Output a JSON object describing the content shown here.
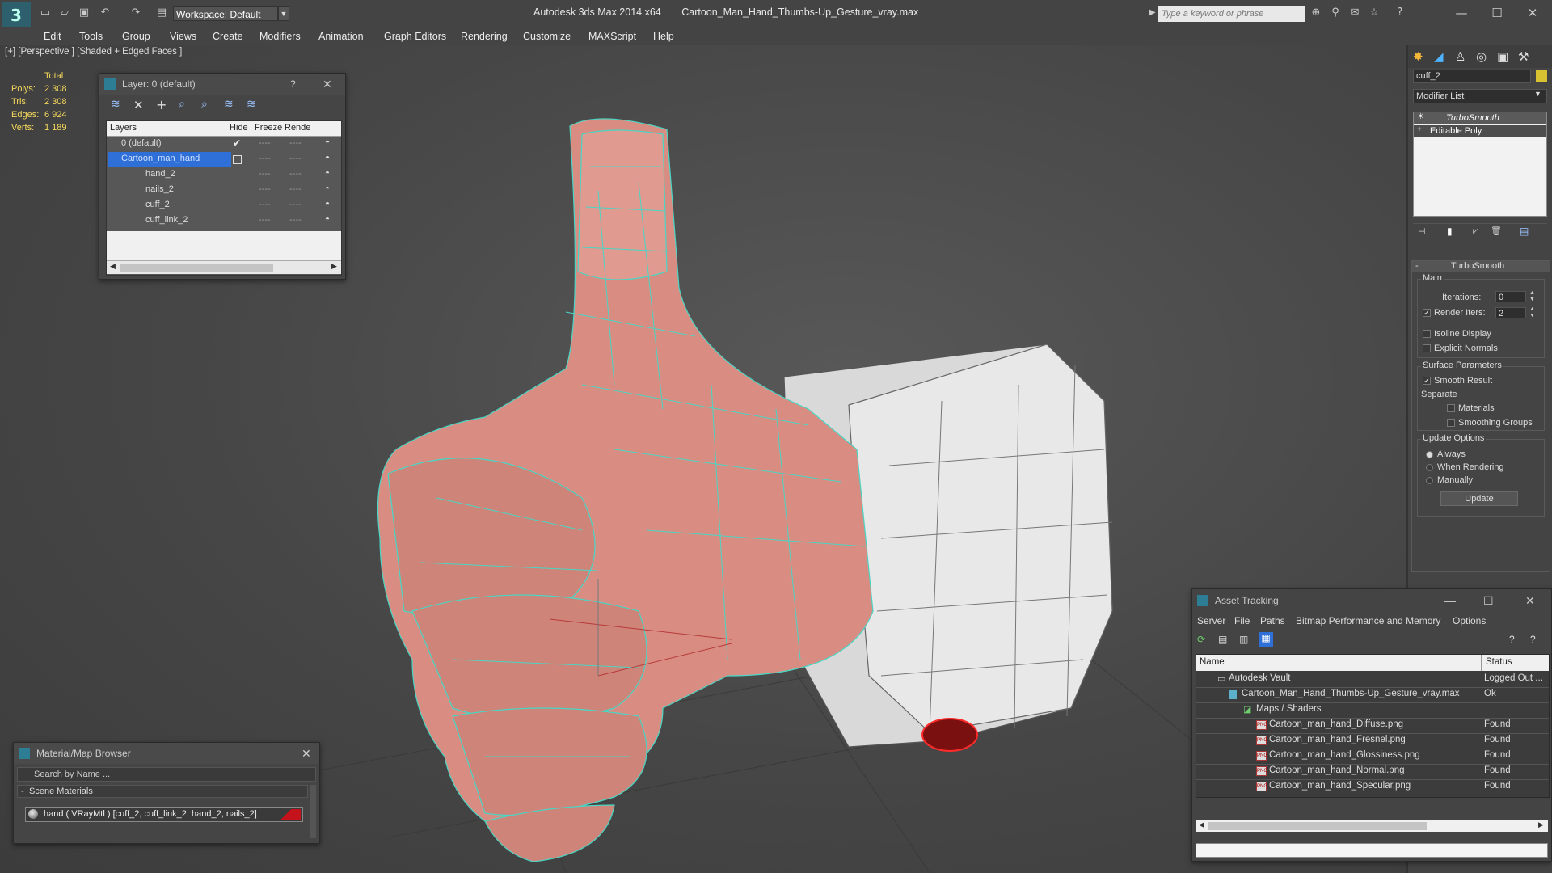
{
  "titlebar": {
    "app_title": "Autodesk 3ds Max  2014 x64",
    "file_title": "Cartoon_Man_Hand_Thumbs-Up_Gesture_vray.max",
    "workspace_label": "Workspace: Default",
    "search_placeholder": "Type a keyword or phrase"
  },
  "menu": [
    "Edit",
    "Tools",
    "Group",
    "Views",
    "Create",
    "Modifiers",
    "Animation",
    "Graph Editors",
    "Rendering",
    "Customize",
    "MAXScript",
    "Help"
  ],
  "viewport": {
    "label": "[+] [Perspective ] [Shaded + Edged Faces ]",
    "stats": {
      "header": "Total",
      "rows": [
        {
          "label": "Polys:",
          "value": "2 308"
        },
        {
          "label": "Tris:",
          "value": "2 308"
        },
        {
          "label": "Edges:",
          "value": "6 924"
        },
        {
          "label": "Verts:",
          "value": "1 189"
        }
      ]
    }
  },
  "layer_panel": {
    "title": "Layer: 0 (default)",
    "help": "?",
    "columns": [
      "Layers",
      "Hide",
      "Freeze",
      "Rende"
    ],
    "rows": [
      {
        "name": "0 (default)"
      },
      {
        "name": "Cartoon_man_hand"
      },
      {
        "name": "hand_2"
      },
      {
        "name": "nails_2"
      },
      {
        "name": "cuff_2"
      },
      {
        "name": "cuff_link_2"
      }
    ],
    "dots": "----"
  },
  "material_browser": {
    "title": "Material/Map Browser",
    "search_placeholder": "Search by Name ...",
    "section": "Scene Materials",
    "material": "hand  ( VRayMtl )  [cuff_2, cuff_link_2, hand_2, nails_2]"
  },
  "command_panel": {
    "object_name": "cuff_2",
    "modifier_list": "Modifier List",
    "stack": [
      "TurboSmooth",
      "Editable Poly"
    ],
    "rollout_title": "TurboSmooth",
    "main_group": "Main",
    "iterations_label": "Iterations:",
    "iterations_value": "0",
    "render_iters_label": "Render Iters:",
    "render_iters_value": "2",
    "isoline_label": "Isoline Display",
    "explicit_label": "Explicit Normals",
    "surface_group": "Surface Parameters",
    "smooth_result_label": "Smooth Result",
    "separate_label": "Separate",
    "materials_label": "Materials",
    "smoothing_groups_label": "Smoothing Groups",
    "update_group": "Update Options",
    "update_always": "Always",
    "update_when_rendering": "When Rendering",
    "update_manually": "Manually",
    "update_button": "Update"
  },
  "asset_tracking": {
    "title": "Asset Tracking",
    "menu": [
      "Server",
      "File",
      "Paths",
      "Bitmap Performance and Memory",
      "Options"
    ],
    "columns": {
      "name": "Name",
      "status": "Status"
    },
    "rows": [
      {
        "name": "Autodesk Vault",
        "status": "Logged Out ..."
      },
      {
        "name": "Cartoon_Man_Hand_Thumbs-Up_Gesture_vray.max",
        "status": "Ok"
      },
      {
        "name": "Maps / Shaders",
        "status": ""
      },
      {
        "name": "Cartoon_man_hand_Diffuse.png",
        "status": "Found"
      },
      {
        "name": "Cartoon_man_hand_Fresnel.png",
        "status": "Found"
      },
      {
        "name": "Cartoon_man_hand_Glossiness.png",
        "status": "Found"
      },
      {
        "name": "Cartoon_man_hand_Normal.png",
        "status": "Found"
      },
      {
        "name": "Cartoon_man_hand_Specular.png",
        "status": "Found"
      }
    ]
  },
  "colors": {
    "selection": "#2f6fd8",
    "wire": "#49d6c4",
    "skin": "#d98d82",
    "stat_yellow": "#f5d85c"
  }
}
